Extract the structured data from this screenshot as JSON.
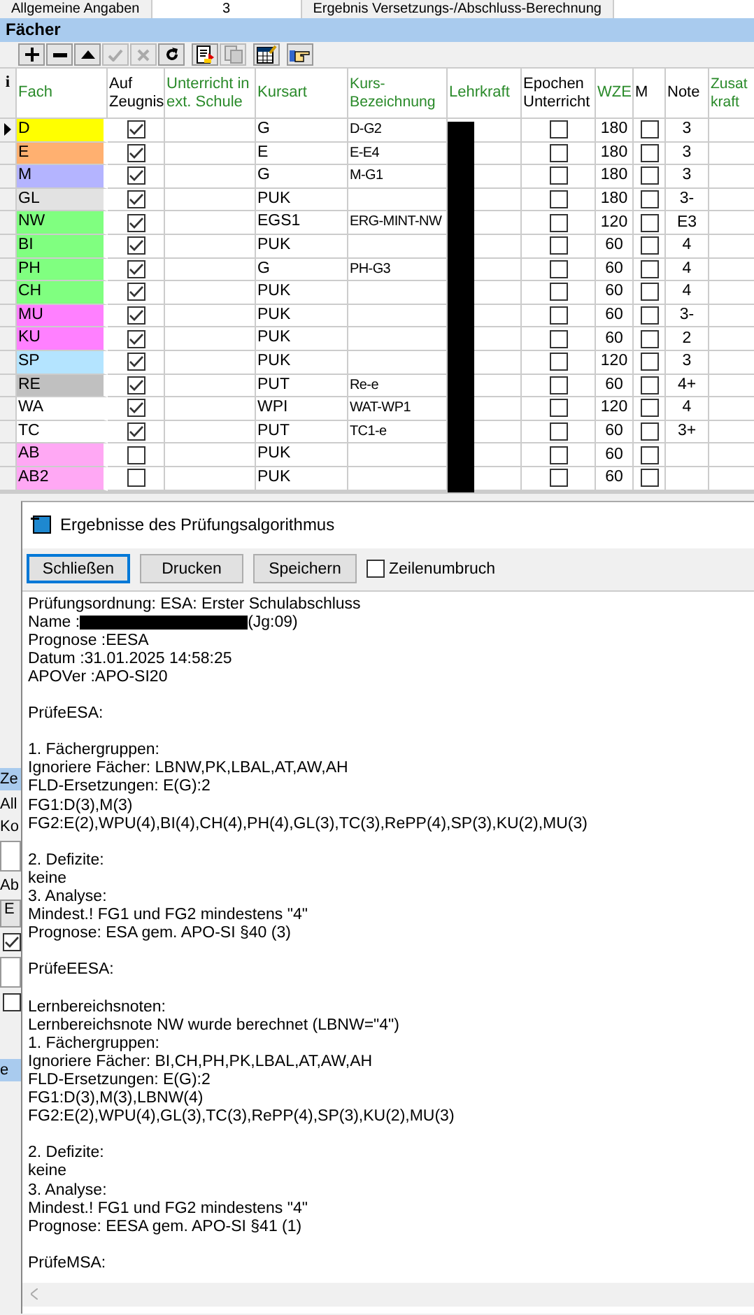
{
  "top_tabs": [
    {
      "label": "Allgemeine Angaben",
      "selected": false
    },
    {
      "label": "3",
      "selected": true
    },
    {
      "label": "Ergebnis Versetzungs-/Abschluss-Berechnung",
      "selected": false
    }
  ],
  "section_title": "Fächer",
  "toolbar": [
    {
      "kind": "add",
      "disabled": false
    },
    {
      "kind": "remove",
      "disabled": false
    },
    {
      "kind": "up",
      "disabled": false
    },
    {
      "kind": "confirm",
      "disabled": true
    },
    {
      "kind": "cancel",
      "disabled": true
    },
    {
      "kind": "refresh",
      "disabled": false
    },
    {
      "kind": "document",
      "disabled": false
    },
    {
      "kind": "copy",
      "disabled": true
    },
    {
      "kind": "table",
      "disabled": false
    },
    {
      "kind": "hand",
      "disabled": false
    }
  ],
  "table": {
    "info_header": "i",
    "columns": [
      "Fach",
      "Auf Zeugnis",
      "Unterricht in ext. Schule",
      "Kursart",
      "Kurs-Bezeichnung",
      "Lehrkraft",
      "Epochen Unterricht",
      "WZE",
      "M",
      "Note",
      "Zusat kraft"
    ],
    "rows": [
      {
        "subject": "D",
        "color": "#ffff00",
        "selected": true,
        "on_report": true,
        "course_type": "G",
        "course_name": "D-G2",
        "epoch": false,
        "wze": "180",
        "m": false,
        "grade": "3"
      },
      {
        "subject": "E",
        "color": "#ffb070",
        "selected": false,
        "on_report": true,
        "course_type": "E",
        "course_name": "E-E4",
        "epoch": false,
        "wze": "180",
        "m": false,
        "grade": "3"
      },
      {
        "subject": "M",
        "color": "#b4b4ff",
        "selected": false,
        "on_report": true,
        "course_type": "G",
        "course_name": "M-G1",
        "epoch": false,
        "wze": "180",
        "m": false,
        "grade": "3"
      },
      {
        "subject": "GL",
        "color": "#e2e2e2",
        "selected": false,
        "on_report": true,
        "course_type": "PUK",
        "epoch": false,
        "wze": "180",
        "m": false,
        "grade": "3-"
      },
      {
        "subject": "NW",
        "color": "#80ff80",
        "selected": false,
        "on_report": true,
        "course_type": "EGS1",
        "course_name": "ERG-MINT-NW",
        "epoch": false,
        "wze": "120",
        "m": false,
        "grade": "E3"
      },
      {
        "subject": "BI",
        "color": "#80ff80",
        "selected": false,
        "on_report": true,
        "course_type": "PUK",
        "epoch": false,
        "wze": "60",
        "m": false,
        "grade": "4"
      },
      {
        "subject": "PH",
        "color": "#80ff80",
        "selected": false,
        "on_report": true,
        "course_type": "G",
        "course_name": "PH-G3",
        "epoch": false,
        "wze": "60",
        "m": false,
        "grade": "4"
      },
      {
        "subject": "CH",
        "color": "#80ff80",
        "selected": false,
        "on_report": true,
        "course_type": "PUK",
        "epoch": false,
        "wze": "60",
        "m": false,
        "grade": "4"
      },
      {
        "subject": "MU",
        "color": "#ff80ff",
        "selected": false,
        "on_report": true,
        "course_type": "PUK",
        "epoch": false,
        "wze": "60",
        "m": false,
        "grade": "3-"
      },
      {
        "subject": "KU",
        "color": "#ff80ff",
        "selected": false,
        "on_report": true,
        "course_type": "PUK",
        "epoch": false,
        "wze": "60",
        "m": false,
        "grade": "2"
      },
      {
        "subject": "SP",
        "color": "#b4e4ff",
        "selected": false,
        "on_report": true,
        "course_type": "PUK",
        "epoch": false,
        "wze": "120",
        "m": false,
        "grade": "3"
      },
      {
        "subject": "RE",
        "color": "#c0c0c0",
        "selected": false,
        "on_report": true,
        "course_type": "PUT",
        "course_name": "Re-e",
        "epoch": false,
        "wze": "60",
        "m": false,
        "grade": "4+"
      },
      {
        "subject": "WA",
        "color": "#ffffff",
        "selected": false,
        "on_report": true,
        "course_type": "WPI",
        "course_name": "WAT-WP1",
        "epoch": false,
        "wze": "120",
        "m": false,
        "grade": "4"
      },
      {
        "subject": "TC",
        "color": "#ffffff",
        "selected": false,
        "on_report": true,
        "course_type": "PUT",
        "course_name": "TC1-e",
        "epoch": false,
        "wze": "60",
        "m": false,
        "grade": "3+"
      },
      {
        "subject": "AB",
        "color": "#ffa8f4",
        "selected": false,
        "on_report": false,
        "course_type": "PUK",
        "epoch": false,
        "wze": "60",
        "m": false
      },
      {
        "subject": "AB2",
        "color": "#ffa8f4",
        "selected": false,
        "on_report": false,
        "course_type": "PUK",
        "epoch": false,
        "wze": "60",
        "m": false
      }
    ]
  },
  "background_fragments": [
    {
      "kind": "bar",
      "text": "Ze"
    },
    {
      "kind": "label",
      "text": "All"
    },
    {
      "kind": "label",
      "text": "Ko"
    },
    {
      "kind": "field"
    },
    {
      "kind": "label",
      "text": "Ab"
    },
    {
      "kind": "button",
      "text": "E"
    },
    {
      "kind": "checkbox",
      "checked": true
    },
    {
      "kind": "field"
    },
    {
      "kind": "checkbox",
      "checked": false
    },
    {
      "kind": "bar",
      "text": "e"
    }
  ],
  "dialog": {
    "title": "Ergebnisse des Prüfungsalgorithmus",
    "buttons": [
      {
        "label": "Schließen",
        "selected": true
      },
      {
        "label": "Drucken",
        "selected": false
      },
      {
        "label": "Speichern",
        "selected": false
      }
    ],
    "wrap_checkbox": {
      "label": "Zeilenumbruch",
      "checked": false
    },
    "blocks": [
      [
        "Prüfungsordnung: ESA: Erster Schulabschluss",
        {
          "before": "Name :",
          "after": " (Jg:09)"
        },
        "Prognose :EESA",
        "Datum :31.01.2025 14:58:25",
        "APOVer :APO-SI20"
      ],
      [
        "PrüfeESA:"
      ],
      [
        "1. Fächergruppen:",
        "Ignoriere Fächer: LBNW,PK,LBAL,AT,AW,AH",
        "FLD-Ersetzungen: E(G):2",
        "FG1:D(3),M(3)",
        "FG2:E(2),WPU(4),BI(4),CH(4),PH(4),GL(3),TC(3),RePP(4),SP(3),KU(2),MU(3)"
      ],
      [
        "2. Defizite:",
        "keine",
        "3. Analyse:",
        "Mindest.! FG1 und FG2 mindestens \"4\"",
        "Prognose: ESA gem. APO-SI §40 (3)"
      ],
      [
        "PrüfeEESA:"
      ],
      [
        "Lernbereichsnoten:",
        "Lernbereichsnote NW wurde berechnet (LBNW=\"4\")",
        "1. Fächergruppen:",
        "Ignoriere Fächer: BI,CH,PH,PK,LBAL,AT,AW,AH",
        "FLD-Ersetzungen: E(G):2",
        "FG1:D(3),M(3),LBNW(4)",
        "FG2:E(2),WPU(4),GL(3),TC(3),RePP(4),SP(3),KU(2),MU(3)"
      ],
      [
        "2. Defizite:",
        "keine",
        "3. Analyse:",
        "Mindest.! FG1 und FG2 mindestens \"4\"",
        "Prognose: EESA gem. APO-SI §41 (1)"
      ],
      [
        "PrüfeMSA:"
      ]
    ]
  }
}
